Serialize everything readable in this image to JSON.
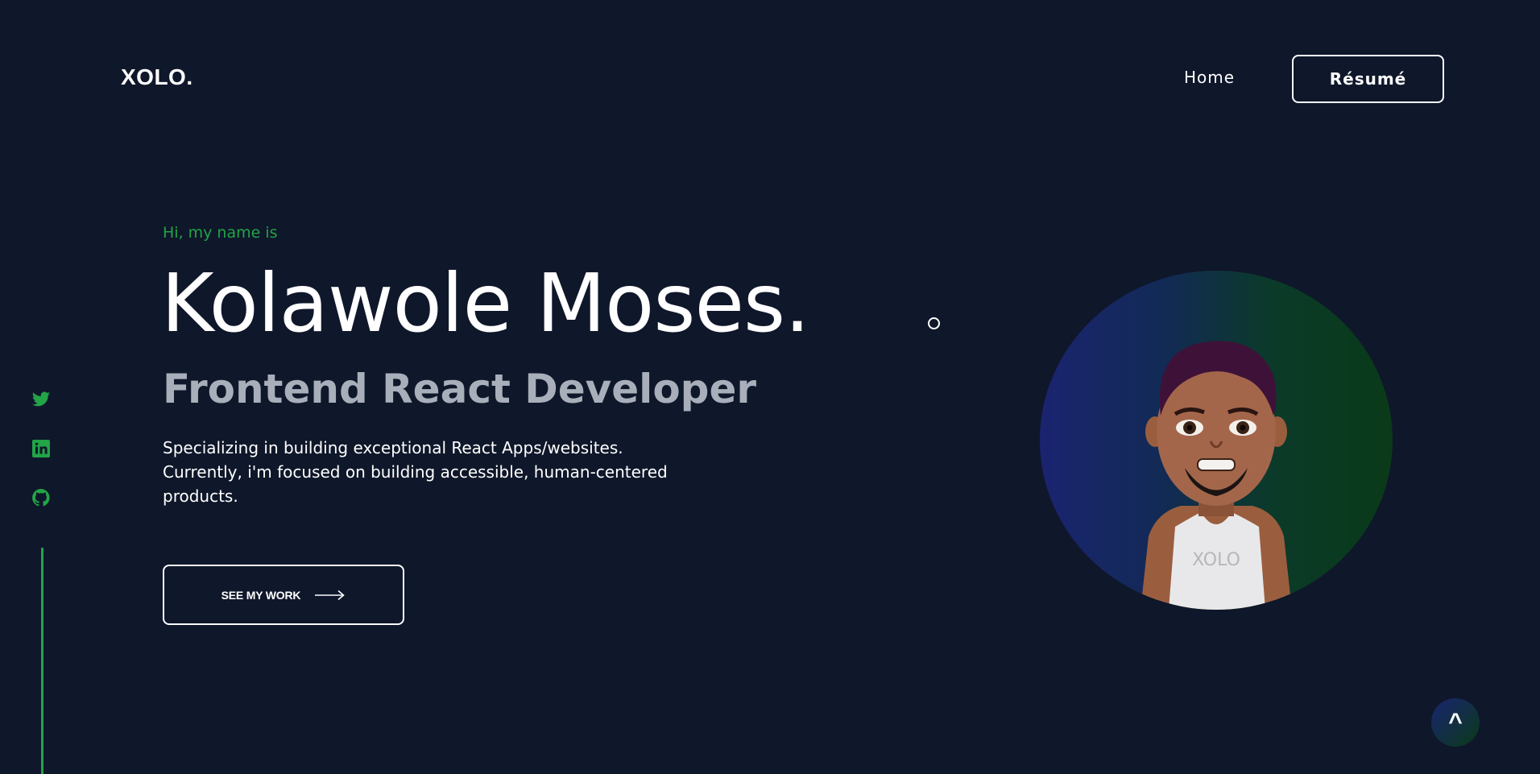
{
  "header": {
    "logo": "XOLO.",
    "nav_home": "Home",
    "resume_label": "Résumé"
  },
  "social": {
    "icons": [
      "twitter-icon",
      "linkedin-icon",
      "github-icon"
    ],
    "accent_color": "#22a447"
  },
  "hero": {
    "greeting": "Hi, my name is",
    "name": "Kolawole Moses.",
    "role": "Frontend React Developer",
    "description": "Specializing in building exceptional React Apps/websites. Currently, i'm focused on building accessible, human-centered products.",
    "cta_label": "SEE MY WORK"
  },
  "avatar": {
    "shirt_text": "XOLO"
  },
  "scroll_top": {
    "label": "^"
  },
  "colors": {
    "background": "#0f172a",
    "accent": "#22a447",
    "muted_text": "#a8afba"
  }
}
